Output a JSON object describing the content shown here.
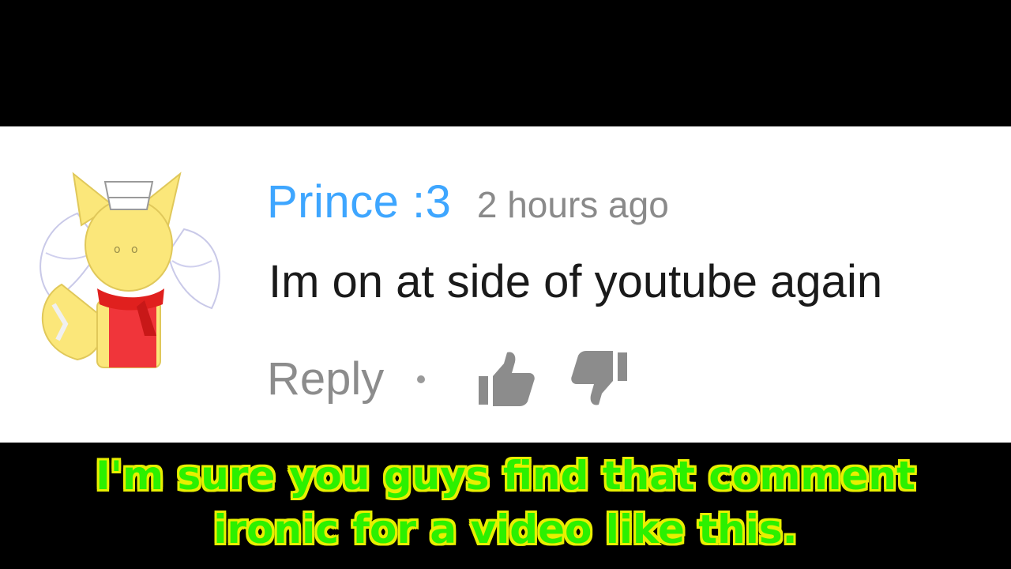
{
  "comment": {
    "author": "Prince :3",
    "timestamp": "2 hours ago",
    "text": "Im on at side of youtube again",
    "reply_label": "Reply",
    "separator": "•",
    "like_icon": "thumbs-up-icon",
    "dislike_icon": "thumbs-down-icon",
    "avatar": "cartoon-fox-avatar"
  },
  "caption": {
    "line1": "I'm sure you guys find that comment",
    "line2": "ironic for a video like this."
  },
  "colors": {
    "author": "#3ea6ff",
    "timestamp": "#8a8a8a",
    "icons": "#8c8c8c",
    "caption_fill": "#2cf000",
    "caption_outline": "#e8ef00"
  }
}
